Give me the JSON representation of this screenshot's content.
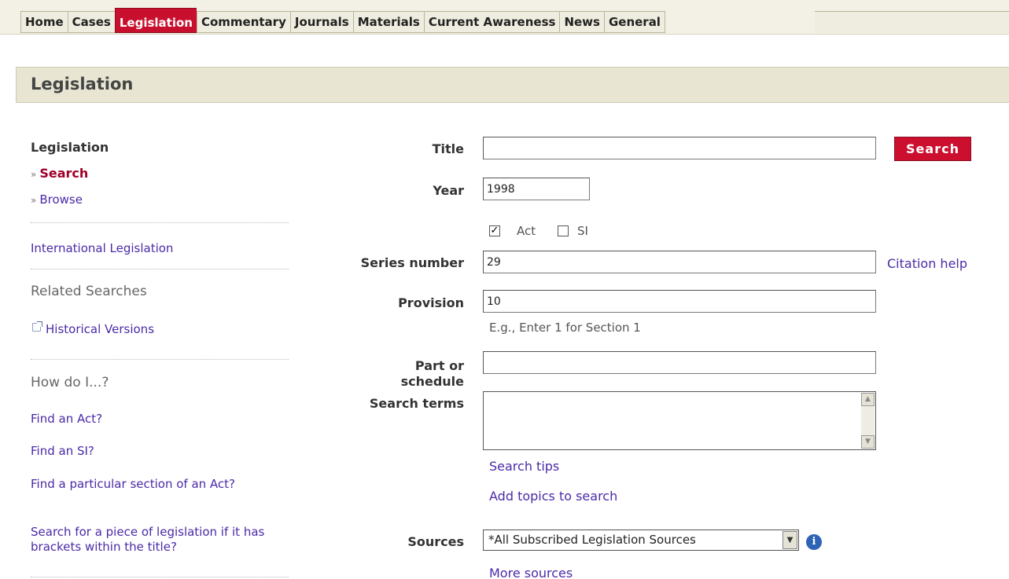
{
  "nav": {
    "tabs": [
      "Home",
      "Cases",
      "Legislation",
      "Commentary",
      "Journals",
      "Materials",
      "Current Awareness",
      "News",
      "General"
    ],
    "active": "Legislation"
  },
  "page": {
    "title": "Legislation"
  },
  "sidebar": {
    "heading": "Legislation",
    "arrow": "»",
    "search": "Search",
    "browse": "Browse",
    "international": "International Legislation",
    "related": "Related Searches",
    "historical": "Historical Versions",
    "howdo": "How do I...?",
    "help": [
      "Find an Act?",
      "Find an SI?",
      "Find a particular section of an Act?",
      "Search for a piece of legislation if it has brackets within the title?"
    ]
  },
  "form": {
    "title_label": "Title",
    "title_value": "",
    "search_button": "Search",
    "year_label": "Year",
    "year_value": "1998",
    "act_label": "Act",
    "act_checked": true,
    "si_label": "SI",
    "si_checked": false,
    "series_label": "Series number",
    "series_value": "29",
    "citation_help": "Citation help",
    "provision_label": "Provision",
    "provision_value": "10",
    "provision_hint": "E.g., Enter 1 for Section 1",
    "part_label_1": "Part or",
    "part_label_2": "schedule",
    "part_value": "",
    "terms_label": "Search terms",
    "search_tips": "Search tips",
    "add_topics": "Add topics to search",
    "sources_label": "Sources",
    "sources_value": "*All Subscribed Legislation Sources",
    "more_sources": "More sources"
  },
  "colors": {
    "accent": "#c8102e",
    "link": "#4b2aa8",
    "titlebar": "#e8e6d2"
  },
  "icons": {
    "info": "info-icon",
    "external": "external-link-icon"
  }
}
